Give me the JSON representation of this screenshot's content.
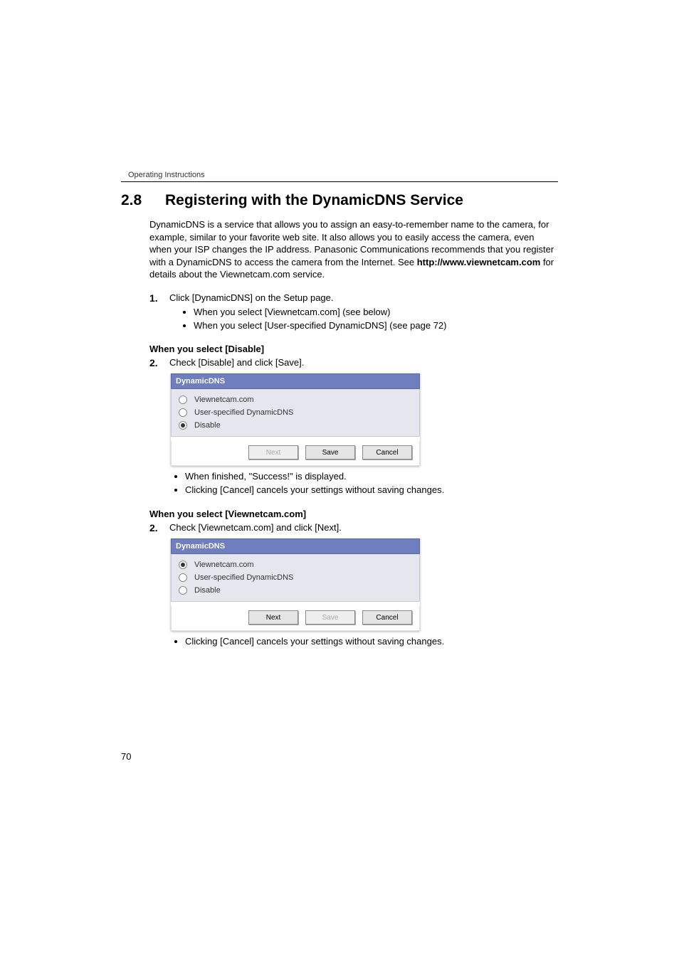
{
  "running_header": "Operating Instructions",
  "section_number": "2.8",
  "section_title": "Registering with the DynamicDNS Service",
  "intro_pre": "DynamicDNS is a service that allows you to assign an easy-to-remember name to the camera, for example, similar to your favorite web site. It also allows you to easily access the camera, even when your ISP changes the IP address. Panasonic Communications recommends that you register with a DynamicDNS to access the camera from the Internet. See ",
  "intro_bold": "http://www.viewnetcam.com",
  "intro_post": " for details about the Viewnetcam.com service.",
  "step1_num": "1.",
  "step1_text": "Click [DynamicDNS] on the Setup page.",
  "step1_bullets": [
    "When you select [Viewnetcam.com] (see below)",
    "When you select [User-specified DynamicDNS] (see page 72)"
  ],
  "disable_heading": "When you select [Disable]",
  "disable_step_num": "2.",
  "disable_step_text": "Check [Disable] and click [Save].",
  "panel_title": "DynamicDNS",
  "options": {
    "viewnetcam": "Viewnetcam.com",
    "userspec": "User-specified DynamicDNS",
    "disable": "Disable"
  },
  "buttons": {
    "next": "Next",
    "save": "Save",
    "cancel": "Cancel"
  },
  "after_disable_bullets": [
    "When finished, \"Success!\" is displayed.",
    "Clicking [Cancel] cancels your settings without saving changes."
  ],
  "viewnetcam_heading": "When you select [Viewnetcam.com]",
  "viewnetcam_step_num": "2.",
  "viewnetcam_step_text": "Check [Viewnetcam.com] and click [Next].",
  "after_viewnetcam_bullets": [
    "Clicking [Cancel] cancels your settings without saving changes."
  ],
  "page_number": "70"
}
